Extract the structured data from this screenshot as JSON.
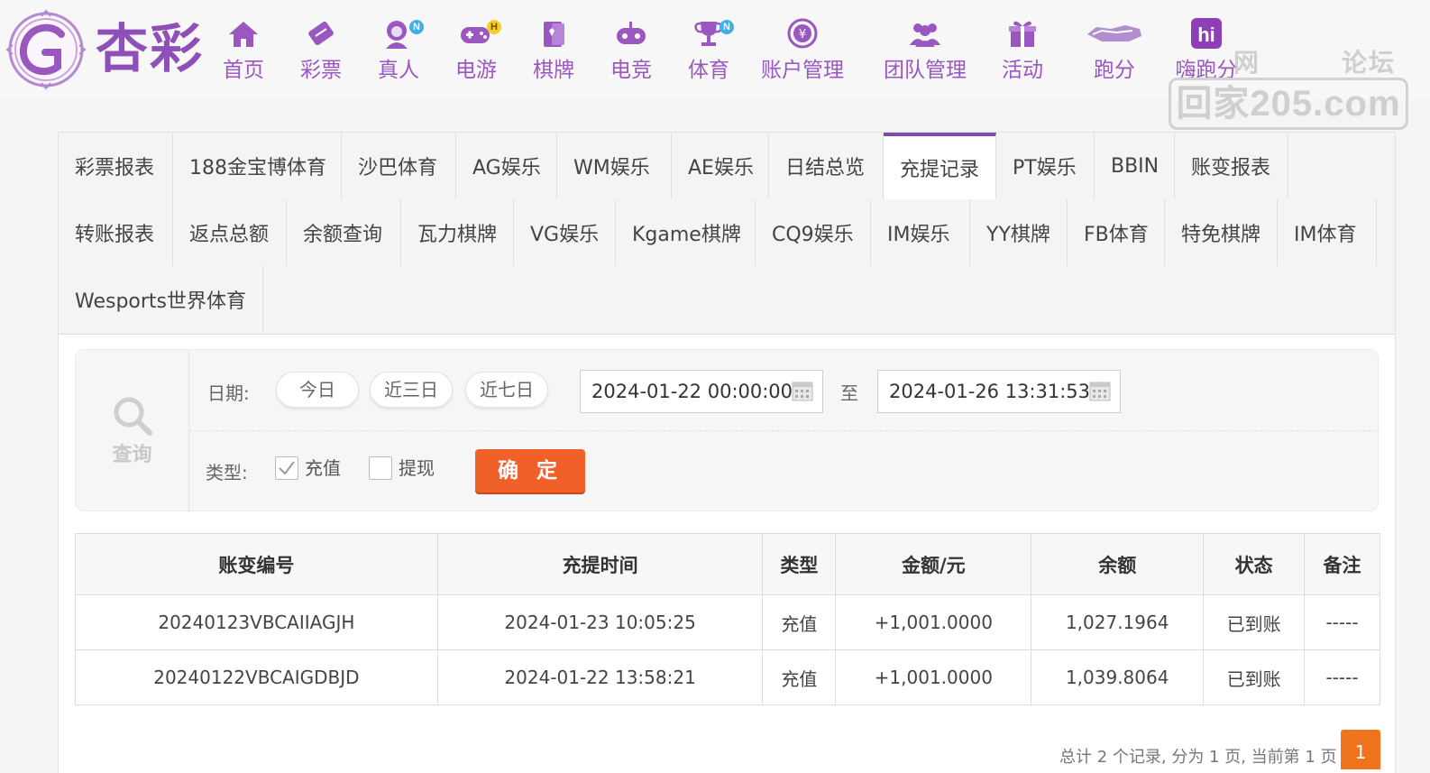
{
  "brand": {
    "logo_text": "杏彩",
    "colors": {
      "primary": "#9a57c0",
      "accent": "#f0612a",
      "amount": "#e02020",
      "status": "#18a018"
    }
  },
  "nav": {
    "items": [
      {
        "label": "首页",
        "icon": "home-icon",
        "badge": ""
      },
      {
        "label": "彩票",
        "icon": "lottery-ticket-icon",
        "badge": ""
      },
      {
        "label": "真人",
        "icon": "live-dealer-icon",
        "badge": "N"
      },
      {
        "label": "电游",
        "icon": "gamepad-icon",
        "badge": "H"
      },
      {
        "label": "棋牌",
        "icon": "cards-icon",
        "badge": ""
      },
      {
        "label": "电竞",
        "icon": "esports-controller-icon",
        "badge": ""
      },
      {
        "label": "体育",
        "icon": "trophy-icon",
        "badge": "N"
      },
      {
        "label": "账户管理",
        "icon": "account-icon",
        "badge": ""
      },
      {
        "label": "团队管理",
        "icon": "team-icon",
        "badge": ""
      },
      {
        "label": "活动",
        "icon": "gift-icon",
        "badge": ""
      },
      {
        "label": "跑分",
        "icon": "running-score-icon",
        "badge": ""
      },
      {
        "label": "嗨跑分",
        "icon": "hi-icon",
        "badge": ""
      }
    ]
  },
  "watermark": {
    "top_left": "网",
    "top_right": "论坛",
    "domain": "回家205.com"
  },
  "tabs": {
    "row1": [
      "彩票报表",
      "188金宝博体育",
      "沙巴体育",
      "AG娱乐",
      "WM娱乐",
      "AE娱乐",
      "日结总览",
      "充提记录",
      "PT娱乐",
      "BBIN",
      "账变报表"
    ],
    "row2": [
      "转账报表",
      "返点总额",
      "余额查询",
      "瓦力棋牌",
      "VG娱乐",
      "Kgame棋牌",
      "CQ9娱乐",
      "IM娱乐",
      "YY棋牌",
      "FB体育",
      "特免棋牌",
      "IM体育"
    ],
    "row3": [
      "Wesports世界体育"
    ],
    "active": "充提记录"
  },
  "filter": {
    "query_label": "查询",
    "date_label": "日期:",
    "quick": [
      "今日",
      "近三日",
      "近七日"
    ],
    "start": "2024-01-22 00:00:00",
    "to_label": "至",
    "end": "2024-01-26 13:31:53",
    "type_label": "类型:",
    "types": [
      {
        "label": "充值",
        "checked": true
      },
      {
        "label": "提现",
        "checked": false
      }
    ],
    "confirm": "确 定"
  },
  "table": {
    "headers": [
      "账变编号",
      "充提时间",
      "类型",
      "金额/元",
      "余额",
      "状态",
      "备注"
    ],
    "rows": [
      [
        "20240123VBCAIIAGJH",
        "2024-01-23 10:05:25",
        "充值",
        "+1,001.0000",
        "1,027.1964",
        "已到账",
        "-----"
      ],
      [
        "20240122VBCAIGDBJD",
        "2024-01-22 13:58:21",
        "充值",
        "+1,001.0000",
        "1,039.8064",
        "已到账",
        "-----"
      ]
    ]
  },
  "pagination": {
    "summary": "总计 2 个记录, 分为 1 页, 当前第 1 页",
    "current": "1"
  }
}
